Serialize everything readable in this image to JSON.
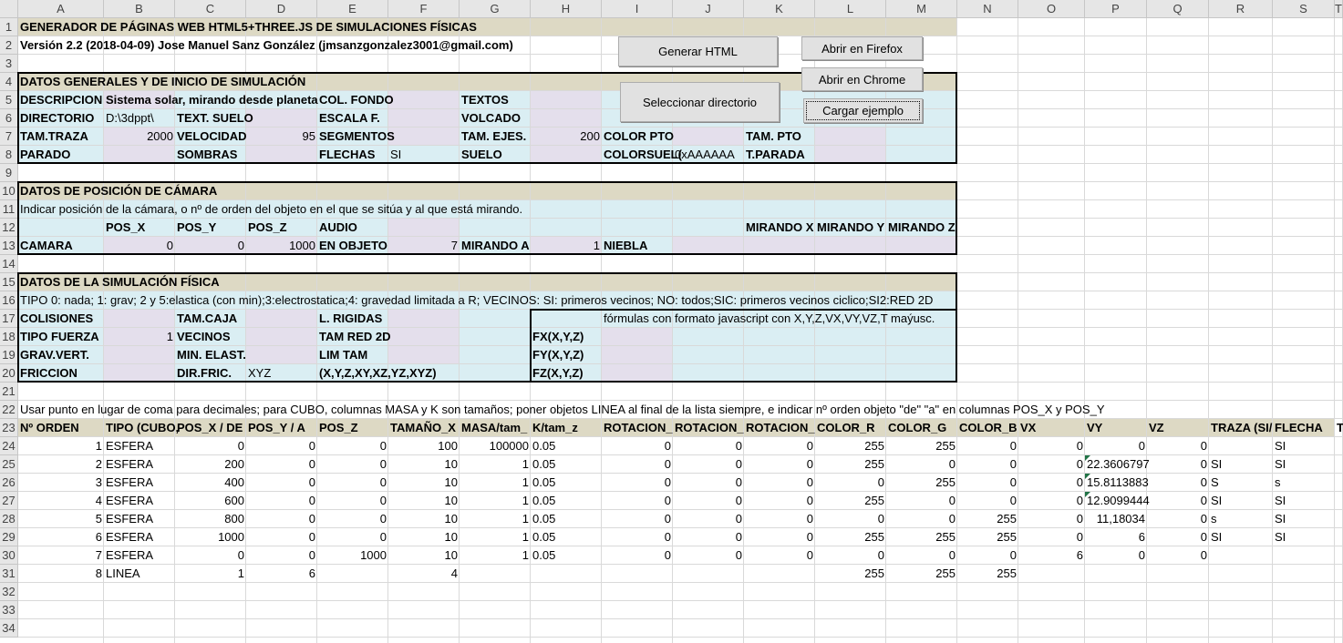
{
  "columns": [
    "A",
    "B",
    "C",
    "D",
    "E",
    "F",
    "G",
    "H",
    "I",
    "J",
    "K",
    "L",
    "M",
    "N",
    "O",
    "P",
    "Q",
    "R",
    "S",
    "T"
  ],
  "rows": [
    "1",
    "2",
    "3",
    "4",
    "5",
    "6",
    "7",
    "8",
    "9",
    "10",
    "11",
    "12",
    "13",
    "14",
    "15",
    "16",
    "17",
    "18",
    "19",
    "20",
    "21",
    "22",
    "23",
    "24",
    "25",
    "26",
    "27",
    "28",
    "29",
    "30",
    "31",
    "32",
    "33",
    "34"
  ],
  "colors": {
    "title_band": "#ddd9c4",
    "section_band": "#ddd9c4",
    "light_blue": "#daeef3",
    "lavender": "#e4dfec",
    "header_row": "#ddd9c4"
  },
  "buttons": {
    "generate": "Generar HTML",
    "firefox": "Abrir en Firefox",
    "chrome": "Abrir en Chrome",
    "select_dir": "Seleccionar directorio",
    "load_example": "Cargar ejemplo"
  },
  "cells": [
    [
      "A1",
      "GENERADOR DE PÁGINAS WEB HTML5+THREE.JS DE SIMULACIONES FÍSICAS",
      "b"
    ],
    [
      "A2",
      "Versión 2.2 (2018-04-09) Jose Manuel Sanz González (jmsanzgonzalez3001@gmail.com)",
      "b"
    ],
    [
      "A4",
      "DATOS GENERALES Y DE INICIO DE SIMULACIÓN",
      "b"
    ],
    [
      "A5",
      "DESCRIPCION",
      "b"
    ],
    [
      "B5",
      "Sistema solar, mirando desde planeta",
      "b"
    ],
    [
      "E5",
      "COL. FONDO",
      "b"
    ],
    [
      "G5",
      "TEXTOS",
      "b"
    ],
    [
      "A6",
      "DIRECTORIO",
      "b"
    ],
    [
      "B6",
      "D:\\3dppt\\",
      ""
    ],
    [
      "C6",
      "TEXT. SUELO",
      "b"
    ],
    [
      "E6",
      "ESCALA F.",
      "b"
    ],
    [
      "G6",
      "VOLCADO",
      "b"
    ],
    [
      "A7",
      "TAM.TRAZA",
      "b"
    ],
    [
      "B7",
      "2000",
      "r"
    ],
    [
      "C7",
      "VELOCIDAD",
      "b"
    ],
    [
      "D7",
      "95",
      "r"
    ],
    [
      "E7",
      "SEGMENTOS",
      "b"
    ],
    [
      "G7",
      "TAM. EJES.",
      "b"
    ],
    [
      "H7",
      "200",
      "r"
    ],
    [
      "I7",
      "COLOR PTO",
      "b"
    ],
    [
      "K7",
      "TAM. PTO",
      "b"
    ],
    [
      "A8",
      "PARADO",
      "b"
    ],
    [
      "C8",
      "SOMBRAS",
      "b"
    ],
    [
      "E8",
      "FLECHAS",
      "b"
    ],
    [
      "F8",
      "SI",
      ""
    ],
    [
      "G8",
      "SUELO",
      "b"
    ],
    [
      "I8",
      "COLORSUEL(",
      "b"
    ],
    [
      "J8",
      "0xAAAAAA",
      ""
    ],
    [
      "K8",
      "T.PARADA",
      "b"
    ],
    [
      "A10",
      "DATOS DE POSICIÓN DE CÁMARA",
      "b"
    ],
    [
      "A11",
      "Indicar posición de la cámara, o nº de orden del objeto en el que se sitúa y al que está mirando.",
      ""
    ],
    [
      "B12",
      "POS_X",
      "b"
    ],
    [
      "C12",
      "POS_Y",
      "b"
    ],
    [
      "D12",
      "POS_Z",
      "b"
    ],
    [
      "E12",
      "AUDIO",
      "b"
    ],
    [
      "K12",
      "MIRANDO X",
      "b"
    ],
    [
      "L12",
      "MIRANDO Y",
      "b"
    ],
    [
      "M12",
      "MIRANDO Z",
      "b"
    ],
    [
      "A13",
      "CAMARA",
      "b"
    ],
    [
      "B13",
      "0",
      "r"
    ],
    [
      "C13",
      "0",
      "r"
    ],
    [
      "D13",
      "1000",
      "r"
    ],
    [
      "E13",
      "EN OBJETO",
      "b"
    ],
    [
      "F13",
      "7",
      "r"
    ],
    [
      "G13",
      "MIRANDO A",
      "b"
    ],
    [
      "H13",
      "1",
      "r"
    ],
    [
      "I13",
      "NIEBLA",
      "b"
    ],
    [
      "A15",
      "DATOS DE LA SIMULACIÓN FÍSICA",
      "b"
    ],
    [
      "A16",
      "TIPO 0: nada; 1: grav; 2 y 5:elastica (con min);3:electrostatica;4: gravedad limitada a R; VECINOS: SI: primeros vecinos; NO: todos;SIC: primeros vecinos ciclico;SI2:RED 2D",
      ""
    ],
    [
      "A17",
      "COLISIONES",
      "b"
    ],
    [
      "C17",
      "TAM.CAJA",
      "b"
    ],
    [
      "E17",
      "L. RIGIDAS",
      "b"
    ],
    [
      "I17",
      "fórmulas con formato javascript con X,Y,Z,VX,VY,VZ,T maýusc.",
      ""
    ],
    [
      "A18",
      "TIPO FUERZA",
      "b"
    ],
    [
      "B18",
      "1",
      "r"
    ],
    [
      "C18",
      "VECINOS",
      "b"
    ],
    [
      "E18",
      "TAM RED 2D",
      "b"
    ],
    [
      "H18",
      "FX(X,Y,Z)",
      "b"
    ],
    [
      "A19",
      "GRAV.VERT.",
      "b"
    ],
    [
      "C19",
      "MIN. ELAST.",
      "b"
    ],
    [
      "E19",
      "LIM TAM",
      "b"
    ],
    [
      "H19",
      "FY(X,Y,Z)",
      "b"
    ],
    [
      "A20",
      "FRICCION",
      "b"
    ],
    [
      "C20",
      "DIR.FRIC.",
      "b"
    ],
    [
      "D20",
      "XYZ",
      ""
    ],
    [
      "E20",
      "(X,Y,Z,XY,XZ,YZ,XYZ)",
      "b"
    ],
    [
      "H20",
      "FZ(X,Y,Z)",
      "b"
    ],
    [
      "A22",
      "Usar punto en lugar de coma para decimales; para CUBO, columnas MASA y K son tamaños; poner objetos LINEA al final de la lista siempre, e indicar nº orden objeto \"de\" \"a\" en columnas POS_X y POS_Y",
      ""
    ],
    [
      "A23",
      "Nº ORDEN",
      "b"
    ],
    [
      "B23",
      "TIPO (CUBO,",
      "b"
    ],
    [
      "C23",
      "POS_X / DE",
      "b"
    ],
    [
      "D23",
      "POS_Y / A",
      "b"
    ],
    [
      "E23",
      "POS_Z",
      "b"
    ],
    [
      "F23",
      "TAMAÑO_X",
      "b"
    ],
    [
      "G23",
      "MASA/tam_",
      "b"
    ],
    [
      "H23",
      "K/tam_z",
      "b"
    ],
    [
      "I23",
      "ROTACION_",
      "b"
    ],
    [
      "J23",
      "ROTACION_",
      "b"
    ],
    [
      "K23",
      "ROTACION_",
      "b"
    ],
    [
      "L23",
      "COLOR_R",
      "b"
    ],
    [
      "M23",
      "COLOR_G",
      "b"
    ],
    [
      "N23",
      "COLOR_B",
      "b"
    ],
    [
      "O23",
      "VX",
      "b"
    ],
    [
      "P23",
      "VY",
      "b"
    ],
    [
      "Q23",
      "VZ",
      "b"
    ],
    [
      "R23",
      "TRAZA (SI/",
      "b"
    ],
    [
      "S23",
      "FLECHA",
      "b"
    ],
    [
      "T23",
      "T",
      "b"
    ],
    [
      "A24",
      "1",
      "r"
    ],
    [
      "B24",
      "ESFERA",
      ""
    ],
    [
      "C24",
      "0",
      "r"
    ],
    [
      "D24",
      "0",
      "r"
    ],
    [
      "E24",
      "0",
      "r"
    ],
    [
      "F24",
      "100",
      "r"
    ],
    [
      "G24",
      "100000",
      "r"
    ],
    [
      "H24",
      "0.05",
      ""
    ],
    [
      "I24",
      "0",
      "r"
    ],
    [
      "J24",
      "0",
      "r"
    ],
    [
      "K24",
      "0",
      "r"
    ],
    [
      "L24",
      "255",
      "r"
    ],
    [
      "M24",
      "255",
      "r"
    ],
    [
      "N24",
      "0",
      "r"
    ],
    [
      "O24",
      "0",
      "r"
    ],
    [
      "P24",
      "0",
      "r"
    ],
    [
      "Q24",
      "0",
      "r"
    ],
    [
      "S24",
      "SI",
      ""
    ],
    [
      "A25",
      "2",
      "r"
    ],
    [
      "B25",
      "ESFERA",
      ""
    ],
    [
      "C25",
      "200",
      "r"
    ],
    [
      "D25",
      "0",
      "r"
    ],
    [
      "E25",
      "0",
      "r"
    ],
    [
      "F25",
      "10",
      "r"
    ],
    [
      "G25",
      "1",
      "r"
    ],
    [
      "H25",
      "0.05",
      ""
    ],
    [
      "I25",
      "0",
      "r"
    ],
    [
      "J25",
      "0",
      "r"
    ],
    [
      "K25",
      "0",
      "r"
    ],
    [
      "L25",
      "255",
      "r"
    ],
    [
      "M25",
      "0",
      "r"
    ],
    [
      "N25",
      "0",
      "r"
    ],
    [
      "O25",
      "0",
      "r"
    ],
    [
      "P25",
      "22.3606797",
      ""
    ],
    [
      "Q25",
      "0",
      "r"
    ],
    [
      "R25",
      "SI",
      ""
    ],
    [
      "S25",
      "SI",
      ""
    ],
    [
      "A26",
      "3",
      "r"
    ],
    [
      "B26",
      "ESFERA",
      ""
    ],
    [
      "C26",
      "400",
      "r"
    ],
    [
      "D26",
      "0",
      "r"
    ],
    [
      "E26",
      "0",
      "r"
    ],
    [
      "F26",
      "10",
      "r"
    ],
    [
      "G26",
      "1",
      "r"
    ],
    [
      "H26",
      "0.05",
      ""
    ],
    [
      "I26",
      "0",
      "r"
    ],
    [
      "J26",
      "0",
      "r"
    ],
    [
      "K26",
      "0",
      "r"
    ],
    [
      "L26",
      "0",
      "r"
    ],
    [
      "M26",
      "255",
      "r"
    ],
    [
      "N26",
      "0",
      "r"
    ],
    [
      "O26",
      "0",
      "r"
    ],
    [
      "P26",
      "15.8113883",
      ""
    ],
    [
      "Q26",
      "0",
      "r"
    ],
    [
      "R26",
      "S",
      ""
    ],
    [
      "S26",
      "s",
      ""
    ],
    [
      "A27",
      "4",
      "r"
    ],
    [
      "B27",
      "ESFERA",
      ""
    ],
    [
      "C27",
      "600",
      "r"
    ],
    [
      "D27",
      "0",
      "r"
    ],
    [
      "E27",
      "0",
      "r"
    ],
    [
      "F27",
      "10",
      "r"
    ],
    [
      "G27",
      "1",
      "r"
    ],
    [
      "H27",
      "0.05",
      ""
    ],
    [
      "I27",
      "0",
      "r"
    ],
    [
      "J27",
      "0",
      "r"
    ],
    [
      "K27",
      "0",
      "r"
    ],
    [
      "L27",
      "255",
      "r"
    ],
    [
      "M27",
      "0",
      "r"
    ],
    [
      "N27",
      "0",
      "r"
    ],
    [
      "O27",
      "0",
      "r"
    ],
    [
      "P27",
      "12.9099444",
      ""
    ],
    [
      "Q27",
      "0",
      "r"
    ],
    [
      "R27",
      "SI",
      ""
    ],
    [
      "S27",
      "SI",
      ""
    ],
    [
      "A28",
      "5",
      "r"
    ],
    [
      "B28",
      "ESFERA",
      ""
    ],
    [
      "C28",
      "800",
      "r"
    ],
    [
      "D28",
      "0",
      "r"
    ],
    [
      "E28",
      "0",
      "r"
    ],
    [
      "F28",
      "10",
      "r"
    ],
    [
      "G28",
      "1",
      "r"
    ],
    [
      "H28",
      "0.05",
      ""
    ],
    [
      "I28",
      "0",
      "r"
    ],
    [
      "J28",
      "0",
      "r"
    ],
    [
      "K28",
      "0",
      "r"
    ],
    [
      "L28",
      "0",
      "r"
    ],
    [
      "M28",
      "0",
      "r"
    ],
    [
      "N28",
      "255",
      "r"
    ],
    [
      "O28",
      "0",
      "r"
    ],
    [
      "P28",
      "11,18034",
      "r"
    ],
    [
      "Q28",
      "0",
      "r"
    ],
    [
      "R28",
      "s",
      ""
    ],
    [
      "S28",
      "SI",
      ""
    ],
    [
      "A29",
      "6",
      "r"
    ],
    [
      "B29",
      "ESFERA",
      ""
    ],
    [
      "C29",
      "1000",
      "r"
    ],
    [
      "D29",
      "0",
      "r"
    ],
    [
      "E29",
      "0",
      "r"
    ],
    [
      "F29",
      "10",
      "r"
    ],
    [
      "G29",
      "1",
      "r"
    ],
    [
      "H29",
      "0.05",
      ""
    ],
    [
      "I29",
      "0",
      "r"
    ],
    [
      "J29",
      "0",
      "r"
    ],
    [
      "K29",
      "0",
      "r"
    ],
    [
      "L29",
      "255",
      "r"
    ],
    [
      "M29",
      "255",
      "r"
    ],
    [
      "N29",
      "255",
      "r"
    ],
    [
      "O29",
      "0",
      "r"
    ],
    [
      "P29",
      "6",
      "r"
    ],
    [
      "Q29",
      "0",
      "r"
    ],
    [
      "R29",
      "SI",
      ""
    ],
    [
      "S29",
      "SI",
      ""
    ],
    [
      "A30",
      "7",
      "r"
    ],
    [
      "B30",
      "ESFERA",
      ""
    ],
    [
      "C30",
      "0",
      "r"
    ],
    [
      "D30",
      "0",
      "r"
    ],
    [
      "E30",
      "1000",
      "r"
    ],
    [
      "F30",
      "10",
      "r"
    ],
    [
      "G30",
      "1",
      "r"
    ],
    [
      "H30",
      "0.05",
      ""
    ],
    [
      "I30",
      "0",
      "r"
    ],
    [
      "J30",
      "0",
      "r"
    ],
    [
      "K30",
      "0",
      "r"
    ],
    [
      "L30",
      "0",
      "r"
    ],
    [
      "M30",
      "0",
      "r"
    ],
    [
      "N30",
      "0",
      "r"
    ],
    [
      "O30",
      "6",
      "r"
    ],
    [
      "P30",
      "0",
      "r"
    ],
    [
      "Q30",
      "0",
      "r"
    ],
    [
      "A31",
      "8",
      "r"
    ],
    [
      "B31",
      "LINEA",
      ""
    ],
    [
      "C31",
      "1",
      "r"
    ],
    [
      "D31",
      "6",
      "r"
    ],
    [
      "F31",
      "4",
      "r"
    ],
    [
      "L31",
      "255",
      "r"
    ],
    [
      "M31",
      "255",
      "r"
    ],
    [
      "N31",
      "255",
      "r"
    ]
  ]
}
